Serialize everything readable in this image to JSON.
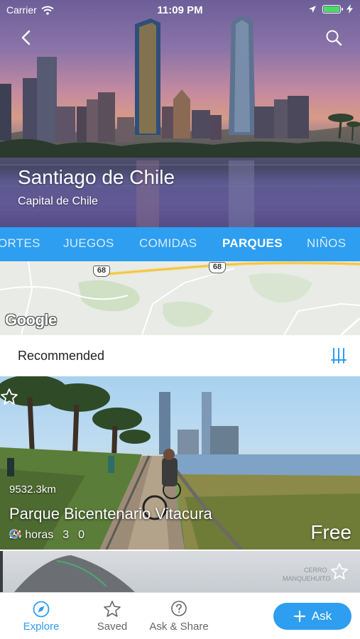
{
  "status_bar": {
    "carrier": "Carrier",
    "time": "11:09 PM"
  },
  "hero": {
    "title": "Santiago de Chile",
    "subtitle": "Capital de Chile"
  },
  "tabs": [
    {
      "label": "ORTES",
      "active": false
    },
    {
      "label": "JUEGOS",
      "active": false
    },
    {
      "label": "COMIDAS",
      "active": false
    },
    {
      "label": "PARQUES",
      "active": true
    },
    {
      "label": "NIÑOS",
      "active": false
    }
  ],
  "map": {
    "route_shields": [
      "68",
      "68"
    ],
    "logo": "Google"
  },
  "recommended": {
    "label": "Recommended"
  },
  "cards": [
    {
      "distance": "9532.3km",
      "name": "Parque Bicentenario Vitacura",
      "hours": "24 horas",
      "likes": "3",
      "comments": "0",
      "price": "Free"
    },
    {
      "image_text": [
        "CERRO",
        "MANQUEHUITO"
      ]
    }
  ],
  "bottom_nav": {
    "explore": "Explore",
    "saved": "Saved",
    "ask_share": "Ask & Share",
    "ask_button": "Ask"
  },
  "colors": {
    "accent": "#2d9ef0",
    "battery": "#4cd964",
    "likes_icon": "#e8552e"
  }
}
